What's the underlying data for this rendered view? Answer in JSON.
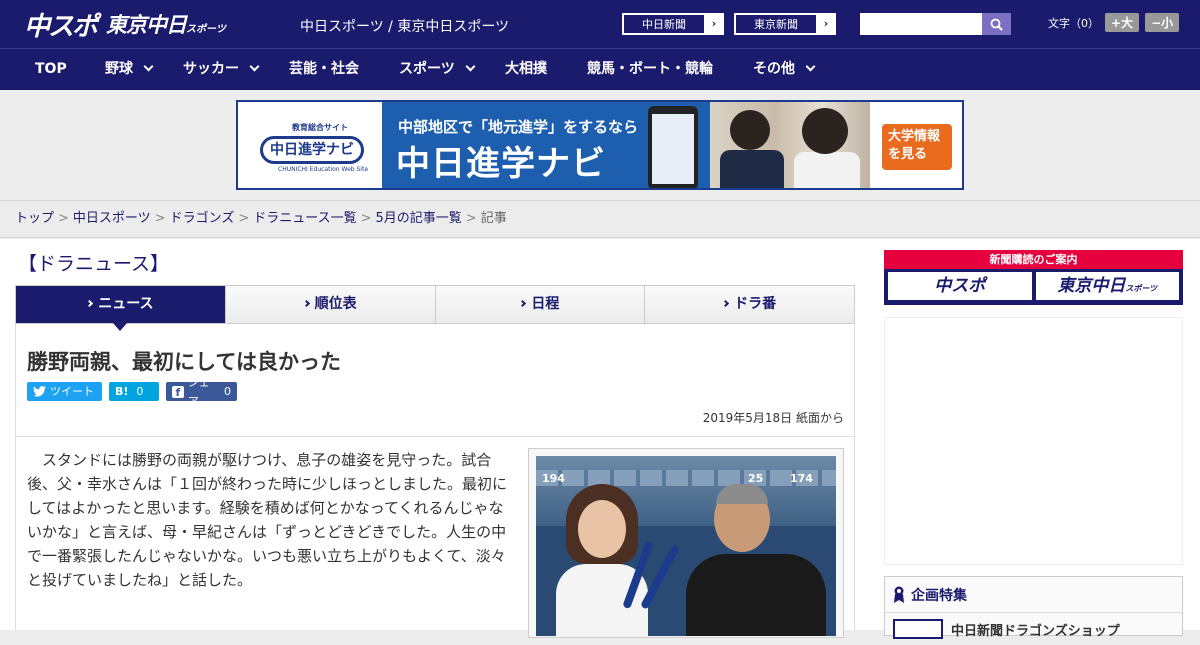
{
  "header": {
    "logo_main": "中スポ",
    "logo_sub": "東京中日",
    "logo_sub_small": "スポーツ",
    "site_name": "中日スポーツ / 東京中日スポーツ",
    "ext_links": [
      {
        "label": "中日新聞"
      },
      {
        "label": "東京新聞"
      }
    ],
    "search": {
      "value": "",
      "placeholder": ""
    },
    "font_size_label": "文字（0）",
    "font_bigger": "+大",
    "font_smaller": "−小"
  },
  "nav": [
    {
      "label": "TOP",
      "dropdown": false
    },
    {
      "label": "野球",
      "dropdown": true
    },
    {
      "label": "サッカー",
      "dropdown": true
    },
    {
      "label": "芸能・社会",
      "dropdown": false
    },
    {
      "label": "スポーツ",
      "dropdown": true
    },
    {
      "label": "大相撲",
      "dropdown": false
    },
    {
      "label": "競馬・ボート・競輪",
      "dropdown": false
    },
    {
      "label": "その他",
      "dropdown": true
    }
  ],
  "banner": {
    "caption": "教育総合サイト",
    "logo": "中日進学ナビ",
    "logo_sub": "CHUNICHI Education Web Site",
    "headline": "中部地区で「地元進学」をするなら",
    "title": "中日進学ナビ",
    "cta": "大学情報を見る"
  },
  "breadcrumb": {
    "items": [
      "トップ",
      "中日スポーツ",
      "ドラゴンズ",
      "ドラニュース一覧",
      "5月の記事一覧"
    ],
    "current": "記事",
    "separator": ">"
  },
  "section_title": "【ドラニュース】",
  "tabs": [
    {
      "label": "ニュース",
      "active": true
    },
    {
      "label": "順位表",
      "active": false
    },
    {
      "label": "日程",
      "active": false
    },
    {
      "label": "ドラ番",
      "active": false
    }
  ],
  "article": {
    "headline": "勝野両親、最初にしては良かった",
    "share": {
      "tweet": "ツイート",
      "hatena_label": "B!",
      "hatena_count": "0",
      "facebook": "シェア",
      "facebook_count": "0"
    },
    "date": "2019年5月18日 紙面から",
    "body": "スタンドには勝野の両親が駆けつけ、息子の雄姿を見守った。試合後、父・幸水さんは「１回が終わった時に少しほっとしました。最初にしてはよかったと思います。経験を積めば何とかなってくれるんじゃないかな」と言えば、母・早紀さんは「ずっとどきどきでした。人生の中で一番緊張したんじゃないかな。いつも悪い立ち上がりもよくて、淡々と投げていましたね」と話した。",
    "photo_stand_numbers": [
      "194",
      "25",
      "174"
    ]
  },
  "sidebar": {
    "subscribe_title": "新聞購読のご案内",
    "subscribe_buttons": [
      "中スポ",
      "東京中日"
    ],
    "subscribe_small": "スポーツ",
    "feature_title": "企画特集",
    "feature_item": "中日新聞ドラゴンズショップ"
  },
  "colors": {
    "brand_navy": "#1b1b6e",
    "accent_red": "#e6003e",
    "twitter": "#1da1f2",
    "hatena": "#00a4de",
    "facebook": "#3b5998"
  }
}
